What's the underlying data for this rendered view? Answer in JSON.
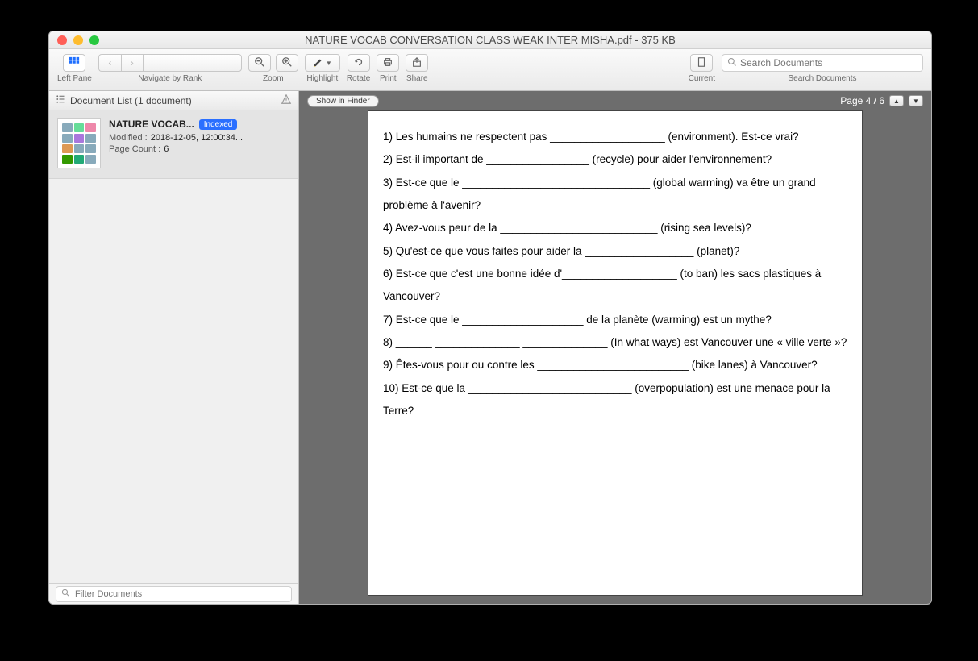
{
  "window": {
    "title": "NATURE VOCAB CONVERSATION CLASS WEAK INTER MISHA.pdf - 375 KB"
  },
  "toolbar": {
    "leftpane_label": "Left Pane",
    "navigate_label": "Navigate by Rank",
    "zoom_label": "Zoom",
    "highlight_label": "Highlight",
    "rotate_label": "Rotate",
    "print_label": "Print",
    "share_label": "Share",
    "current_label": "Current",
    "search_label": "Search Documents",
    "search_placeholder": "Search Documents"
  },
  "sidebar": {
    "header": "Document List (1 document)",
    "filter_placeholder": "Filter Documents",
    "doc": {
      "name": "NATURE VOCAB...",
      "badge": "Indexed",
      "modified_key": "Modified :",
      "modified_val": "2018-12-05, 12:00:34...",
      "pagecount_key": "Page Count :",
      "pagecount_val": "6"
    }
  },
  "content": {
    "show_in_finder": "Show in Finder",
    "page_indicator": "Page 4 / 6",
    "lines": [
      "1) Les humains ne respectent pas ___________________ (environment). Est-ce vrai?",
      "2) Est-il important de _________________ (recycle) pour aider l'environnement?",
      "3) Est-ce que le _______________________________ (global warming) va être un grand problème à l'avenir?",
      "4) Avez-vous peur de la __________________________ (rising sea levels)?",
      "5) Qu'est-ce que vous faites pour aider la __________________ (planet)?",
      "6) Est-ce que c'est une bonne idée d'___________________ (to ban) les sacs plastiques à Vancouver?",
      "7) Est-ce que le ____________________ de la planète (warming) est un mythe?",
      "8) ______ ______________ ______________ (In what ways) est Vancouver une « ville verte »?",
      "9) Êtes-vous pour ou contre les _________________________ (bike lanes) à Vancouver?",
      "10) Est-ce que la ___________________________ (overpopulation) est une menace pour la Terre?"
    ]
  }
}
